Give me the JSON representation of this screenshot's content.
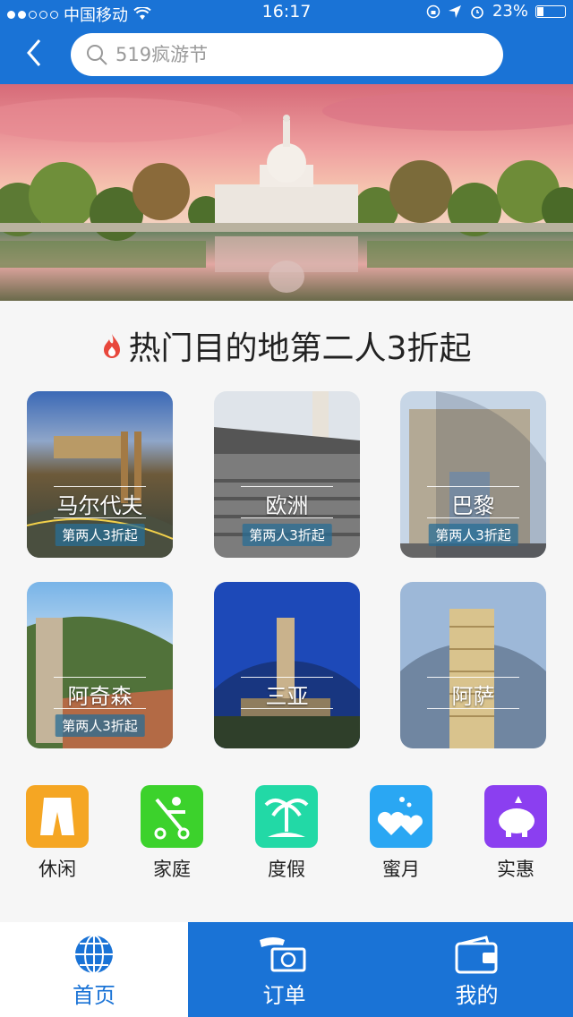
{
  "status_bar": {
    "carrier": "中国移动",
    "time": "16:17",
    "battery": "23%",
    "battery_level": 0.23
  },
  "search": {
    "placeholder": "519疯游节"
  },
  "section": {
    "title": "热门目的地第二人3折起"
  },
  "destinations": [
    {
      "name": "马尔代夫",
      "badge": "第两人3折起"
    },
    {
      "name": "欧洲",
      "badge": "第两人3折起"
    },
    {
      "name": "巴黎",
      "badge": "第两人3折起"
    },
    {
      "name": "阿奇森",
      "badge": "第两人3折起"
    },
    {
      "name": "三亚",
      "badge": ""
    },
    {
      "name": "阿萨",
      "badge": ""
    }
  ],
  "categories": [
    {
      "label": "休闲",
      "icon": "shorts-icon",
      "color": "#f5a623"
    },
    {
      "label": "家庭",
      "icon": "stroller-icon",
      "color": "#3cd22c"
    },
    {
      "label": "度假",
      "icon": "palm-tree-icon",
      "color": "#22d9a6"
    },
    {
      "label": "蜜月",
      "icon": "hearts-icon",
      "color": "#2aa7f3"
    },
    {
      "label": "实惠",
      "icon": "piggy-bank-icon",
      "color": "#8b3ff0"
    }
  ],
  "tabs": [
    {
      "label": "首页",
      "icon": "globe-icon",
      "active": true
    },
    {
      "label": "订单",
      "icon": "money-hand-icon",
      "active": false
    },
    {
      "label": "我的",
      "icon": "wallet-icon",
      "active": false
    }
  ],
  "colors": {
    "primary": "#1a73d6",
    "tab_active_bg": "#ffffff",
    "tab_active_text": "#1a73d6"
  }
}
